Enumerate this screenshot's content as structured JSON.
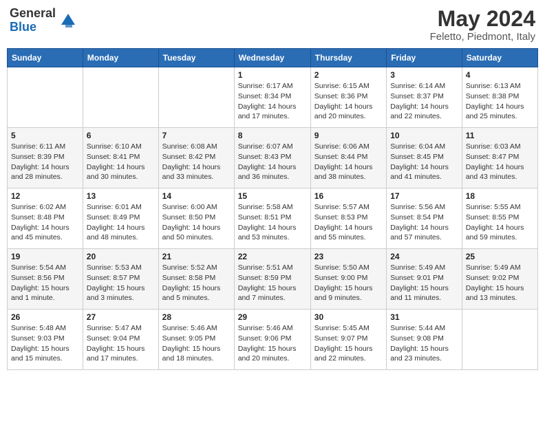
{
  "header": {
    "logo_line1": "General",
    "logo_line2": "Blue",
    "month_title": "May 2024",
    "subtitle": "Feletto, Piedmont, Italy"
  },
  "days_of_week": [
    "Sunday",
    "Monday",
    "Tuesday",
    "Wednesday",
    "Thursday",
    "Friday",
    "Saturday"
  ],
  "weeks": [
    [
      {
        "day": "",
        "info": ""
      },
      {
        "day": "",
        "info": ""
      },
      {
        "day": "",
        "info": ""
      },
      {
        "day": "1",
        "info": "Sunrise: 6:17 AM\nSunset: 8:34 PM\nDaylight: 14 hours and 17 minutes."
      },
      {
        "day": "2",
        "info": "Sunrise: 6:15 AM\nSunset: 8:36 PM\nDaylight: 14 hours and 20 minutes."
      },
      {
        "day": "3",
        "info": "Sunrise: 6:14 AM\nSunset: 8:37 PM\nDaylight: 14 hours and 22 minutes."
      },
      {
        "day": "4",
        "info": "Sunrise: 6:13 AM\nSunset: 8:38 PM\nDaylight: 14 hours and 25 minutes."
      }
    ],
    [
      {
        "day": "5",
        "info": "Sunrise: 6:11 AM\nSunset: 8:39 PM\nDaylight: 14 hours and 28 minutes."
      },
      {
        "day": "6",
        "info": "Sunrise: 6:10 AM\nSunset: 8:41 PM\nDaylight: 14 hours and 30 minutes."
      },
      {
        "day": "7",
        "info": "Sunrise: 6:08 AM\nSunset: 8:42 PM\nDaylight: 14 hours and 33 minutes."
      },
      {
        "day": "8",
        "info": "Sunrise: 6:07 AM\nSunset: 8:43 PM\nDaylight: 14 hours and 36 minutes."
      },
      {
        "day": "9",
        "info": "Sunrise: 6:06 AM\nSunset: 8:44 PM\nDaylight: 14 hours and 38 minutes."
      },
      {
        "day": "10",
        "info": "Sunrise: 6:04 AM\nSunset: 8:45 PM\nDaylight: 14 hours and 41 minutes."
      },
      {
        "day": "11",
        "info": "Sunrise: 6:03 AM\nSunset: 8:47 PM\nDaylight: 14 hours and 43 minutes."
      }
    ],
    [
      {
        "day": "12",
        "info": "Sunrise: 6:02 AM\nSunset: 8:48 PM\nDaylight: 14 hours and 45 minutes."
      },
      {
        "day": "13",
        "info": "Sunrise: 6:01 AM\nSunset: 8:49 PM\nDaylight: 14 hours and 48 minutes."
      },
      {
        "day": "14",
        "info": "Sunrise: 6:00 AM\nSunset: 8:50 PM\nDaylight: 14 hours and 50 minutes."
      },
      {
        "day": "15",
        "info": "Sunrise: 5:58 AM\nSunset: 8:51 PM\nDaylight: 14 hours and 53 minutes."
      },
      {
        "day": "16",
        "info": "Sunrise: 5:57 AM\nSunset: 8:53 PM\nDaylight: 14 hours and 55 minutes."
      },
      {
        "day": "17",
        "info": "Sunrise: 5:56 AM\nSunset: 8:54 PM\nDaylight: 14 hours and 57 minutes."
      },
      {
        "day": "18",
        "info": "Sunrise: 5:55 AM\nSunset: 8:55 PM\nDaylight: 14 hours and 59 minutes."
      }
    ],
    [
      {
        "day": "19",
        "info": "Sunrise: 5:54 AM\nSunset: 8:56 PM\nDaylight: 15 hours and 1 minute."
      },
      {
        "day": "20",
        "info": "Sunrise: 5:53 AM\nSunset: 8:57 PM\nDaylight: 15 hours and 3 minutes."
      },
      {
        "day": "21",
        "info": "Sunrise: 5:52 AM\nSunset: 8:58 PM\nDaylight: 15 hours and 5 minutes."
      },
      {
        "day": "22",
        "info": "Sunrise: 5:51 AM\nSunset: 8:59 PM\nDaylight: 15 hours and 7 minutes."
      },
      {
        "day": "23",
        "info": "Sunrise: 5:50 AM\nSunset: 9:00 PM\nDaylight: 15 hours and 9 minutes."
      },
      {
        "day": "24",
        "info": "Sunrise: 5:49 AM\nSunset: 9:01 PM\nDaylight: 15 hours and 11 minutes."
      },
      {
        "day": "25",
        "info": "Sunrise: 5:49 AM\nSunset: 9:02 PM\nDaylight: 15 hours and 13 minutes."
      }
    ],
    [
      {
        "day": "26",
        "info": "Sunrise: 5:48 AM\nSunset: 9:03 PM\nDaylight: 15 hours and 15 minutes."
      },
      {
        "day": "27",
        "info": "Sunrise: 5:47 AM\nSunset: 9:04 PM\nDaylight: 15 hours and 17 minutes."
      },
      {
        "day": "28",
        "info": "Sunrise: 5:46 AM\nSunset: 9:05 PM\nDaylight: 15 hours and 18 minutes."
      },
      {
        "day": "29",
        "info": "Sunrise: 5:46 AM\nSunset: 9:06 PM\nDaylight: 15 hours and 20 minutes."
      },
      {
        "day": "30",
        "info": "Sunrise: 5:45 AM\nSunset: 9:07 PM\nDaylight: 15 hours and 22 minutes."
      },
      {
        "day": "31",
        "info": "Sunrise: 5:44 AM\nSunset: 9:08 PM\nDaylight: 15 hours and 23 minutes."
      },
      {
        "day": "",
        "info": ""
      }
    ]
  ]
}
